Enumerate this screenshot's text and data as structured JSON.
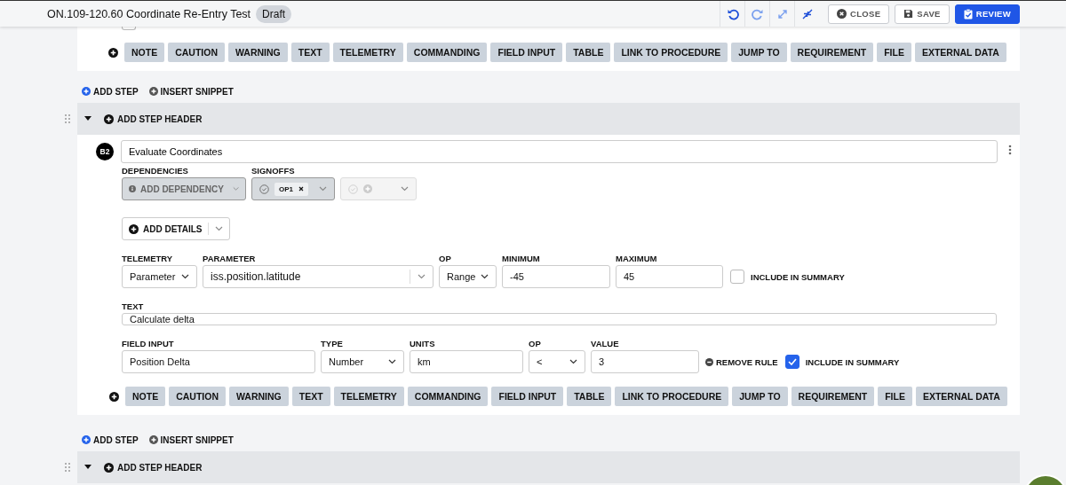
{
  "header": {
    "title": "ON.109-120.60 Coordinate Re-Entry Test",
    "status": "Draft",
    "tools": [
      {
        "kind": "undo",
        "disabled": false
      },
      {
        "kind": "redo",
        "disabled": true
      },
      {
        "kind": "expand",
        "disabled": true
      },
      {
        "kind": "collapse",
        "disabled": false
      }
    ],
    "buttons": [
      {
        "kind": "close",
        "label": "CLOSE"
      },
      {
        "kind": "save",
        "label": "SAVE"
      },
      {
        "kind": "review",
        "label": "REVIEW"
      }
    ]
  },
  "sections": [
    {
      "kind": "toolbar",
      "checkbox": {
        "checked": false
      },
      "block_types": [
        "NOTE",
        "CAUTION",
        "WARNING",
        "TEXT",
        "TELEMETRY",
        "COMMANDING",
        "FIELD INPUT",
        "TABLE",
        "LINK TO PROCEDURE",
        "JUMP TO",
        "REQUIREMENT",
        "FILE",
        "EXTERNAL DATA"
      ]
    },
    {
      "kind": "actions",
      "items": [
        {
          "kind": "add",
          "label": "ADD STEP"
        },
        {
          "kind": "insert",
          "label": "INSERT SNIPPET"
        }
      ]
    },
    {
      "kind": "step_header",
      "label": "ADD STEP HEADER",
      "expanded": true
    },
    {
      "kind": "step",
      "number": "B2",
      "title": "Evaluate Coordinates",
      "dependencies": {
        "label": "DEPENDENCIES",
        "placeholder": "ADD DEPENDENCY"
      },
      "signoffs": {
        "label": "SIGNOFFS",
        "slots": [
          {
            "tags": [
              "OP1"
            ],
            "disabled": false
          },
          {
            "disabled": true
          }
        ]
      },
      "add_details": "ADD DETAILS",
      "rows": [
        {
          "kind": "telemetry",
          "fields": [
            {
              "kind": "select",
              "label": "TELEMETRY",
              "value": "Parameter"
            },
            {
              "kind": "combo",
              "label": "PARAMETER",
              "value": "iss.position.latitude"
            },
            {
              "kind": "select",
              "label": "OP",
              "value": "Range"
            },
            {
              "kind": "input",
              "label": "MINIMUM",
              "value": "-45"
            },
            {
              "kind": "input",
              "label": "MAXIMUM",
              "value": "45"
            }
          ],
          "include_summary": {
            "label": "INCLUDE IN SUMMARY",
            "checked": false
          }
        },
        {
          "kind": "text",
          "fields": [
            {
              "kind": "input",
              "label": "TEXT",
              "value": "Calculate delta"
            }
          ]
        },
        {
          "kind": "field_input",
          "fields": [
            {
              "kind": "input",
              "label": "FIELD INPUT",
              "value": "Position Delta"
            },
            {
              "kind": "select",
              "label": "TYPE",
              "value": "Number"
            },
            {
              "kind": "input",
              "label": "UNITS",
              "value": "km"
            },
            {
              "kind": "select",
              "label": "OP",
              "value": "<"
            },
            {
              "kind": "input",
              "label": "VALUE",
              "value": "3"
            }
          ],
          "remove_rule": "REMOVE RULE",
          "include_summary": {
            "label": "INCLUDE IN SUMMARY",
            "checked": true
          }
        }
      ],
      "block_types": [
        "NOTE",
        "CAUTION",
        "WARNING",
        "TEXT",
        "TELEMETRY",
        "COMMANDING",
        "FIELD INPUT",
        "TABLE",
        "LINK TO PROCEDURE",
        "JUMP TO",
        "REQUIREMENT",
        "FILE",
        "EXTERNAL DATA"
      ]
    },
    {
      "kind": "actions",
      "items": [
        {
          "kind": "add",
          "label": "ADD STEP"
        },
        {
          "kind": "insert",
          "label": "INSERT SNIPPET"
        }
      ]
    },
    {
      "kind": "step_header",
      "label": "ADD STEP HEADER",
      "expanded": true
    }
  ]
}
